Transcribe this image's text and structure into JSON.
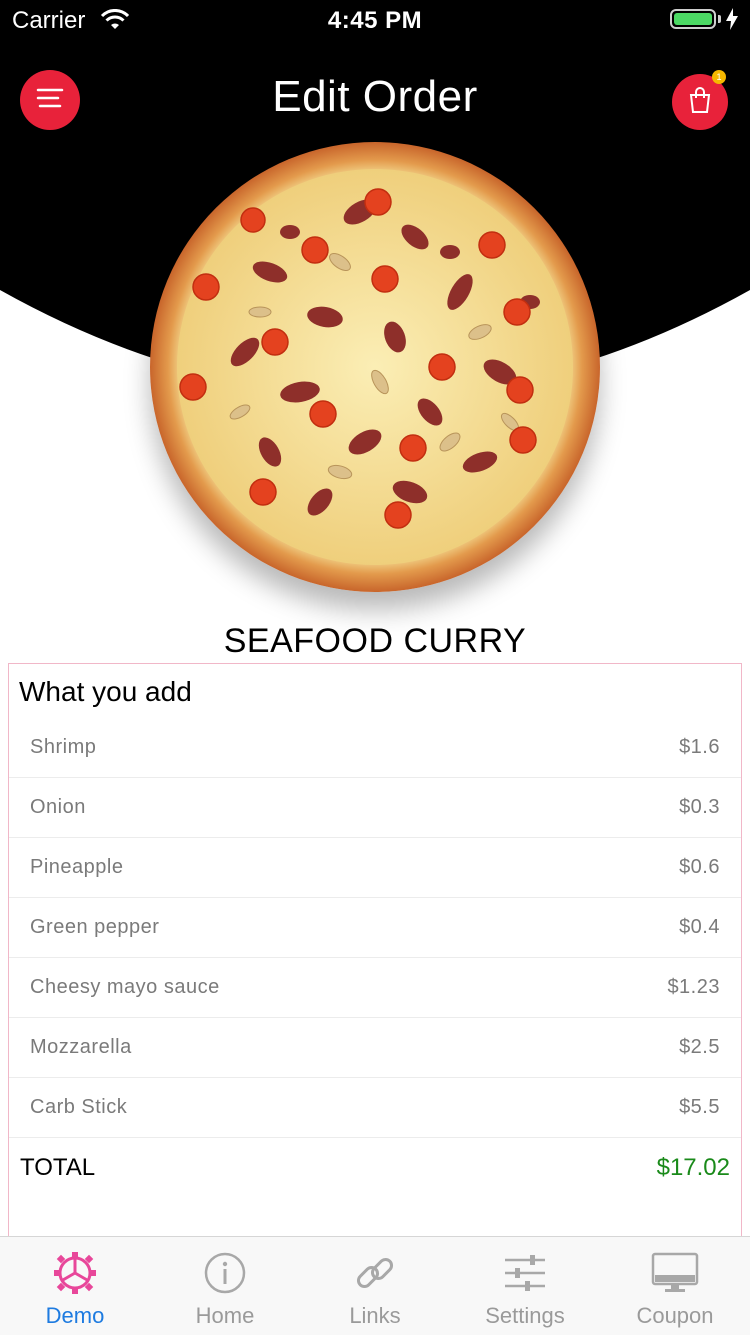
{
  "status_bar": {
    "carrier": "Carrier",
    "time": "4:45 PM"
  },
  "header": {
    "title": "Edit Order",
    "cart_badge": "1"
  },
  "product": {
    "name": "SEAFOOD CURRY"
  },
  "addons": {
    "title": "What you add",
    "items": [
      {
        "name": "Shrimp",
        "price": "$1.6"
      },
      {
        "name": "Onion",
        "price": "$0.3"
      },
      {
        "name": "Pineapple",
        "price": "$0.6"
      },
      {
        "name": "Green pepper",
        "price": "$0.4"
      },
      {
        "name": "Cheesy mayo sauce",
        "price": "$1.23"
      },
      {
        "name": "Mozzarella",
        "price": "$2.5"
      },
      {
        "name": "Carb Stick",
        "price": "$5.5"
      }
    ],
    "total_label": "TOTAL",
    "total_value": "$17.02"
  },
  "tabs": [
    {
      "label": "Demo",
      "icon": "gear-icon",
      "active": true
    },
    {
      "label": "Home",
      "icon": "info-icon",
      "active": false
    },
    {
      "label": "Links",
      "icon": "link-icon",
      "active": false
    },
    {
      "label": "Settings",
      "icon": "sliders-icon",
      "active": false
    },
    {
      "label": "Coupon",
      "icon": "monitor-icon",
      "active": false
    }
  ],
  "colors": {
    "accent": "#e8223a",
    "active_tab": "#1e7be0",
    "active_tab_icon": "#e8479a",
    "total": "#1a8a1a",
    "header_bg": "#000000"
  }
}
